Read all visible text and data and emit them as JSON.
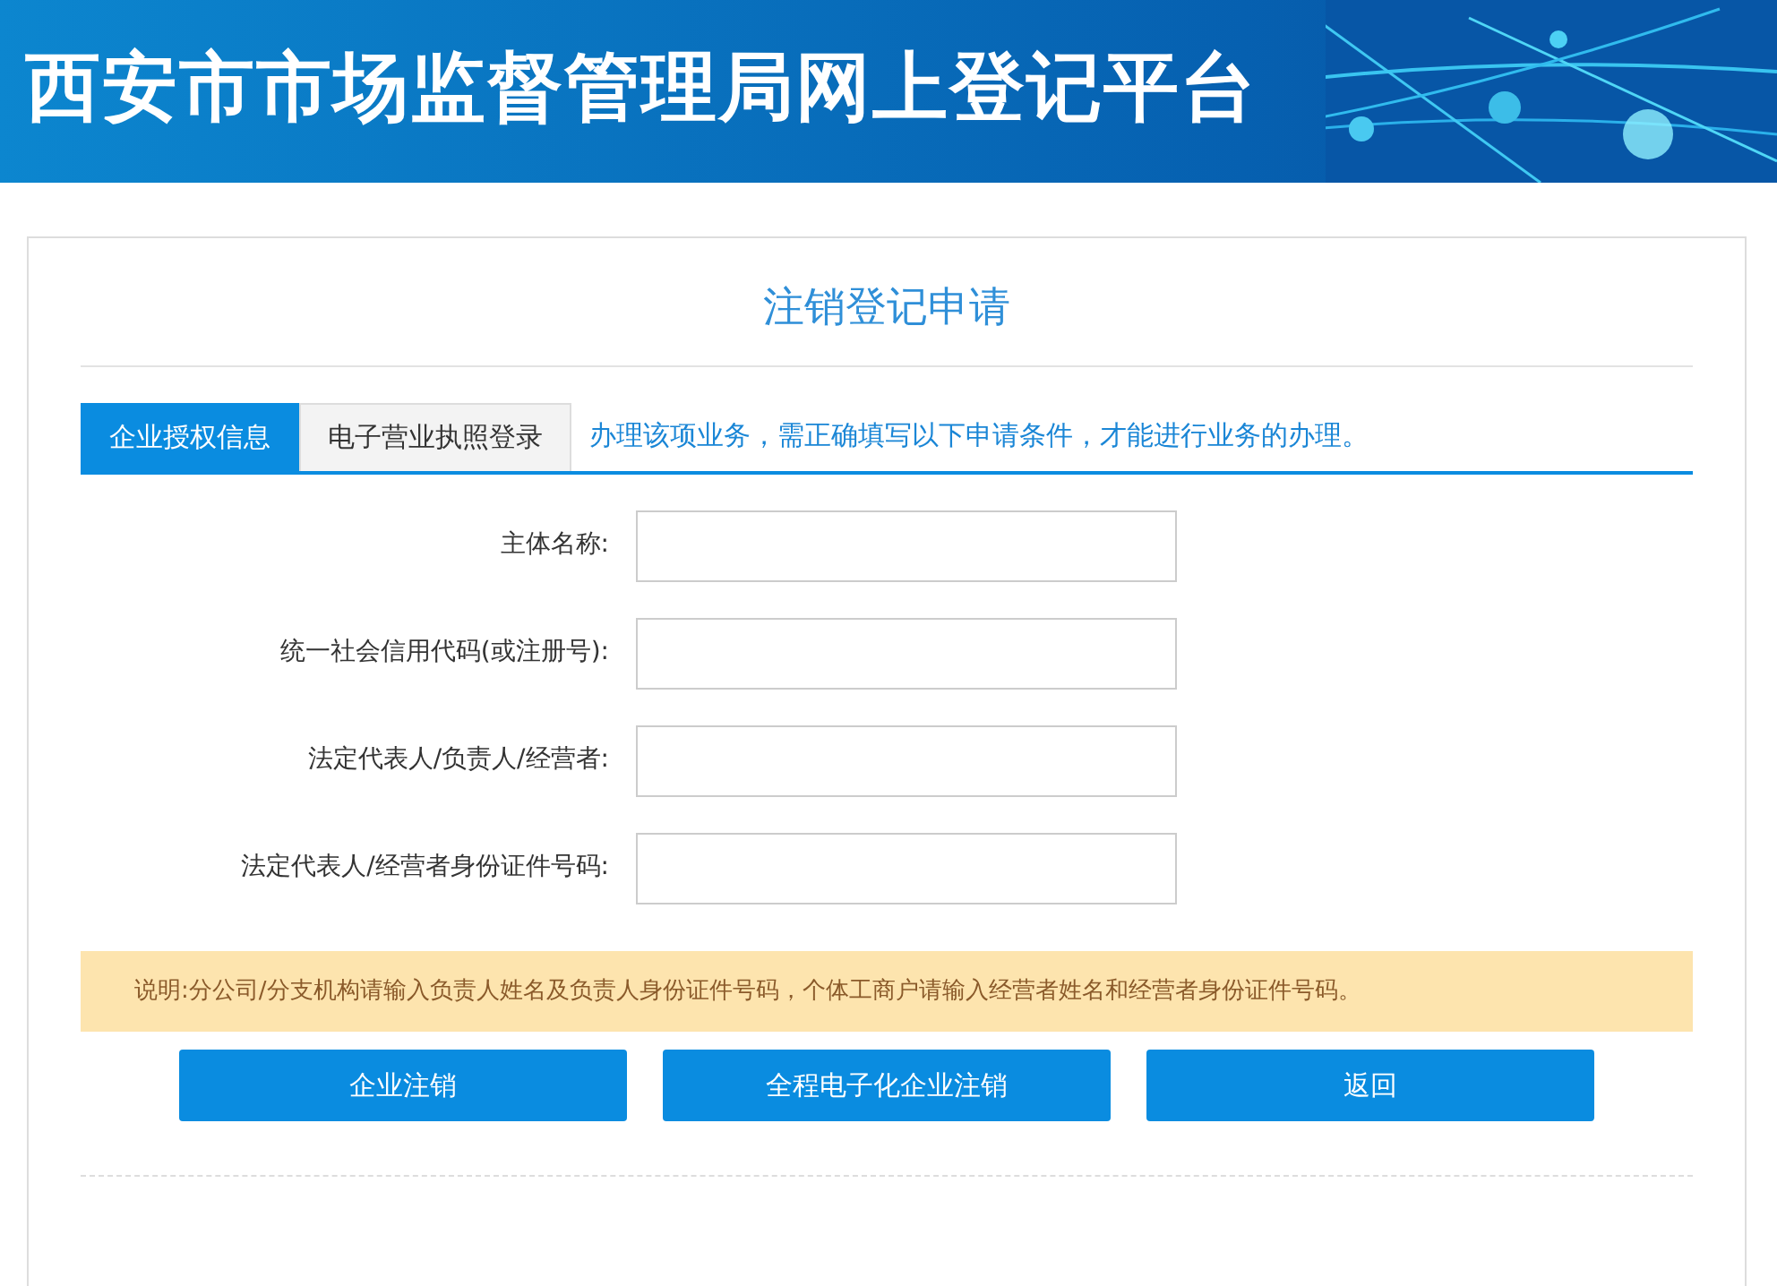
{
  "header": {
    "title": "西安市市场监督管理局网上登记平台"
  },
  "page_title": "注销登记申请",
  "tabs": [
    {
      "label": "企业授权信息",
      "selected": true
    },
    {
      "label": "电子营业执照登录",
      "selected": false
    }
  ],
  "tab_notice": "办理该项业务，需正确填写以下申请条件，才能进行业务的办理。",
  "fields": [
    {
      "label": "主体名称:"
    },
    {
      "label": "统一社会信用代码(或注册号):"
    },
    {
      "label": "法定代表人/负责人/经营者:"
    },
    {
      "label": "法定代表人/经营者身份证件号码:"
    }
  ],
  "note": "说明:分公司/分支机构请输入负责人姓名及负责人身份证件号码，个体工商户请输入经营者姓名和经营者身份证件号码。",
  "buttons": [
    "企业注销",
    "全程电子化企业注销",
    "返回"
  ]
}
